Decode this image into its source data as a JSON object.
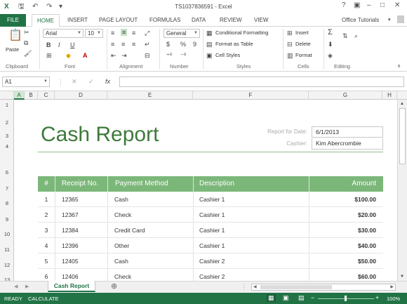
{
  "app": {
    "title": "TS1037836591 - Excel",
    "help": "?",
    "restore": "▣",
    "minimize": "–",
    "maximize": "□",
    "close": "✕"
  },
  "quick_access": {
    "save": "🖫",
    "undo": "↶",
    "redo": "↷",
    "customize": "▾"
  },
  "tabs": [
    "FILE",
    "HOME",
    "INSERT",
    "PAGE LAYOUT",
    "FORMULAS",
    "DATA",
    "REVIEW",
    "VIEW"
  ],
  "account": "Office Tutorials",
  "ribbon": {
    "clipboard": {
      "label": "Clipboard",
      "paste": "Paste"
    },
    "font": {
      "label": "Font",
      "family": "Arial",
      "size": "10",
      "bold": "B",
      "italic": "I",
      "underline": "U"
    },
    "alignment": {
      "label": "Alignment"
    },
    "number": {
      "label": "Number",
      "format": "General",
      "currency": "$",
      "percent": "%",
      "comma": "9"
    },
    "styles": {
      "label": "Styles",
      "conditional": "Conditional Formatting",
      "table": "Format as Table",
      "cell_styles": "Cell Styles"
    },
    "cells": {
      "label": "Cells",
      "insert": "Insert",
      "delete": "Delete",
      "format": "Format"
    },
    "editing": {
      "label": "Editing",
      "sum": "Σ"
    }
  },
  "formula_bar": {
    "name_box": "A1",
    "cancel": "✕",
    "enter": "✓",
    "fx": "fx",
    "value": ""
  },
  "columns": [
    "A",
    "B",
    "C",
    "D",
    "E",
    "F",
    "G",
    "H"
  ],
  "rows": [
    "1",
    "2",
    "3",
    "4",
    "6",
    "7",
    "8",
    "9",
    "10",
    "11",
    "12",
    "13"
  ],
  "report": {
    "title": "Cash Report",
    "date_label": "Report for Date:",
    "date_value": "6/1/2013",
    "cashier_label": "Cashier:",
    "cashier_value": "Kim Abercrombie"
  },
  "table": {
    "headers": [
      "#",
      "Receipt No.",
      "Payment Method",
      "Description",
      "Amount"
    ],
    "rows": [
      [
        "1",
        "12365",
        "Cash",
        "Cashier 1",
        "$100.00"
      ],
      [
        "2",
        "12367",
        "Check",
        "Cashier 1",
        "$20.00"
      ],
      [
        "3",
        "12384",
        "Credit Card",
        "Cashier 1",
        "$30.00"
      ],
      [
        "4",
        "12396",
        "Other",
        "Cashier 1",
        "$40.00"
      ],
      [
        "5",
        "12405",
        "Cash",
        "Cashier 2",
        "$50.00"
      ],
      [
        "6",
        "12406",
        "Check",
        "Cashier 2",
        "$60.00"
      ]
    ]
  },
  "sheet_tabs": {
    "active": "Cash Report",
    "add": "⊕"
  },
  "status": {
    "ready": "READY",
    "calculate": "CALCULATE",
    "zoom": "100%"
  },
  "colors": {
    "excel_green": "#217346",
    "header_green": "#7cb77a",
    "title_green": "#3d7a3a"
  }
}
